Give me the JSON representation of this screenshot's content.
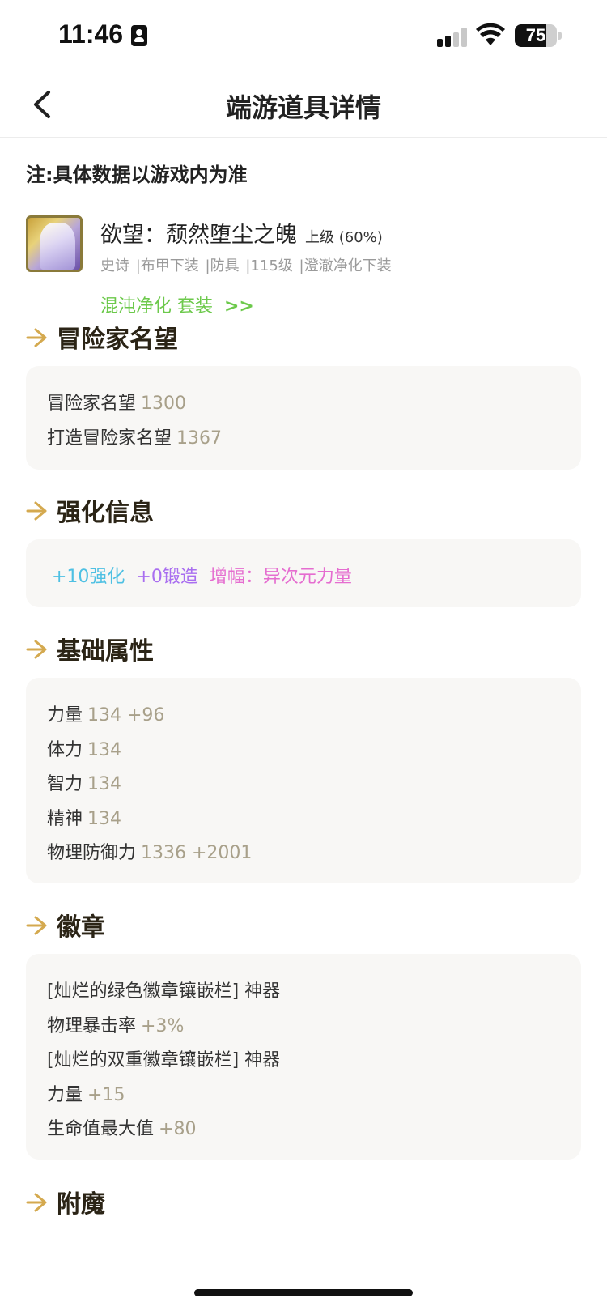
{
  "status": {
    "time": "11:46",
    "battery": "75",
    "battery_level": 0.75
  },
  "nav": {
    "title": "端游道具详情"
  },
  "note": "注:具体数据以游戏内为准",
  "item": {
    "name": "欲望：颓然堕尘之魄",
    "grade": "上级 (60%)",
    "tags": [
      "史诗",
      "|布甲下装",
      "|防具",
      "|115级",
      "|澄澈净化下装"
    ],
    "set_label": "混沌净化 套装",
    "set_arrow": ">>"
  },
  "sections": {
    "renown": {
      "title": "冒险家名望",
      "rows": [
        {
          "k": "冒险家名望",
          "v": "1300"
        },
        {
          "k": "打造冒险家名望",
          "v": "1367"
        }
      ]
    },
    "enhance": {
      "title": "强化信息",
      "reinforce": "+10强化",
      "forge": "+0锻造",
      "amplify": "增幅：异次元力量"
    },
    "basic": {
      "title": "基础属性",
      "rows": [
        {
          "k": "力量",
          "v": "134 +96"
        },
        {
          "k": "体力",
          "v": "134"
        },
        {
          "k": "智力",
          "v": "134"
        },
        {
          "k": "精神",
          "v": "134"
        },
        {
          "k": "物理防御力",
          "v": "1336 +2001"
        }
      ]
    },
    "emblem": {
      "title": "徽章",
      "rows": [
        {
          "k": "[灿烂的绿色徽章镶嵌栏] 神器",
          "v": ""
        },
        {
          "k": "物理暴击率",
          "v": "+3%"
        },
        {
          "k": "[灿烂的双重徽章镶嵌栏] 神器",
          "v": ""
        },
        {
          "k": "力量",
          "v": "+15"
        },
        {
          "k": "生命值最大值",
          "v": "+80"
        }
      ]
    },
    "enchant": {
      "title": "附魔"
    }
  },
  "colors": {
    "section_arrow": "#d4a94f",
    "set_green": "#6cc94b",
    "reinforce": "#4ec0e3",
    "forge": "#a96ef0",
    "amplify": "#e56dd0"
  }
}
